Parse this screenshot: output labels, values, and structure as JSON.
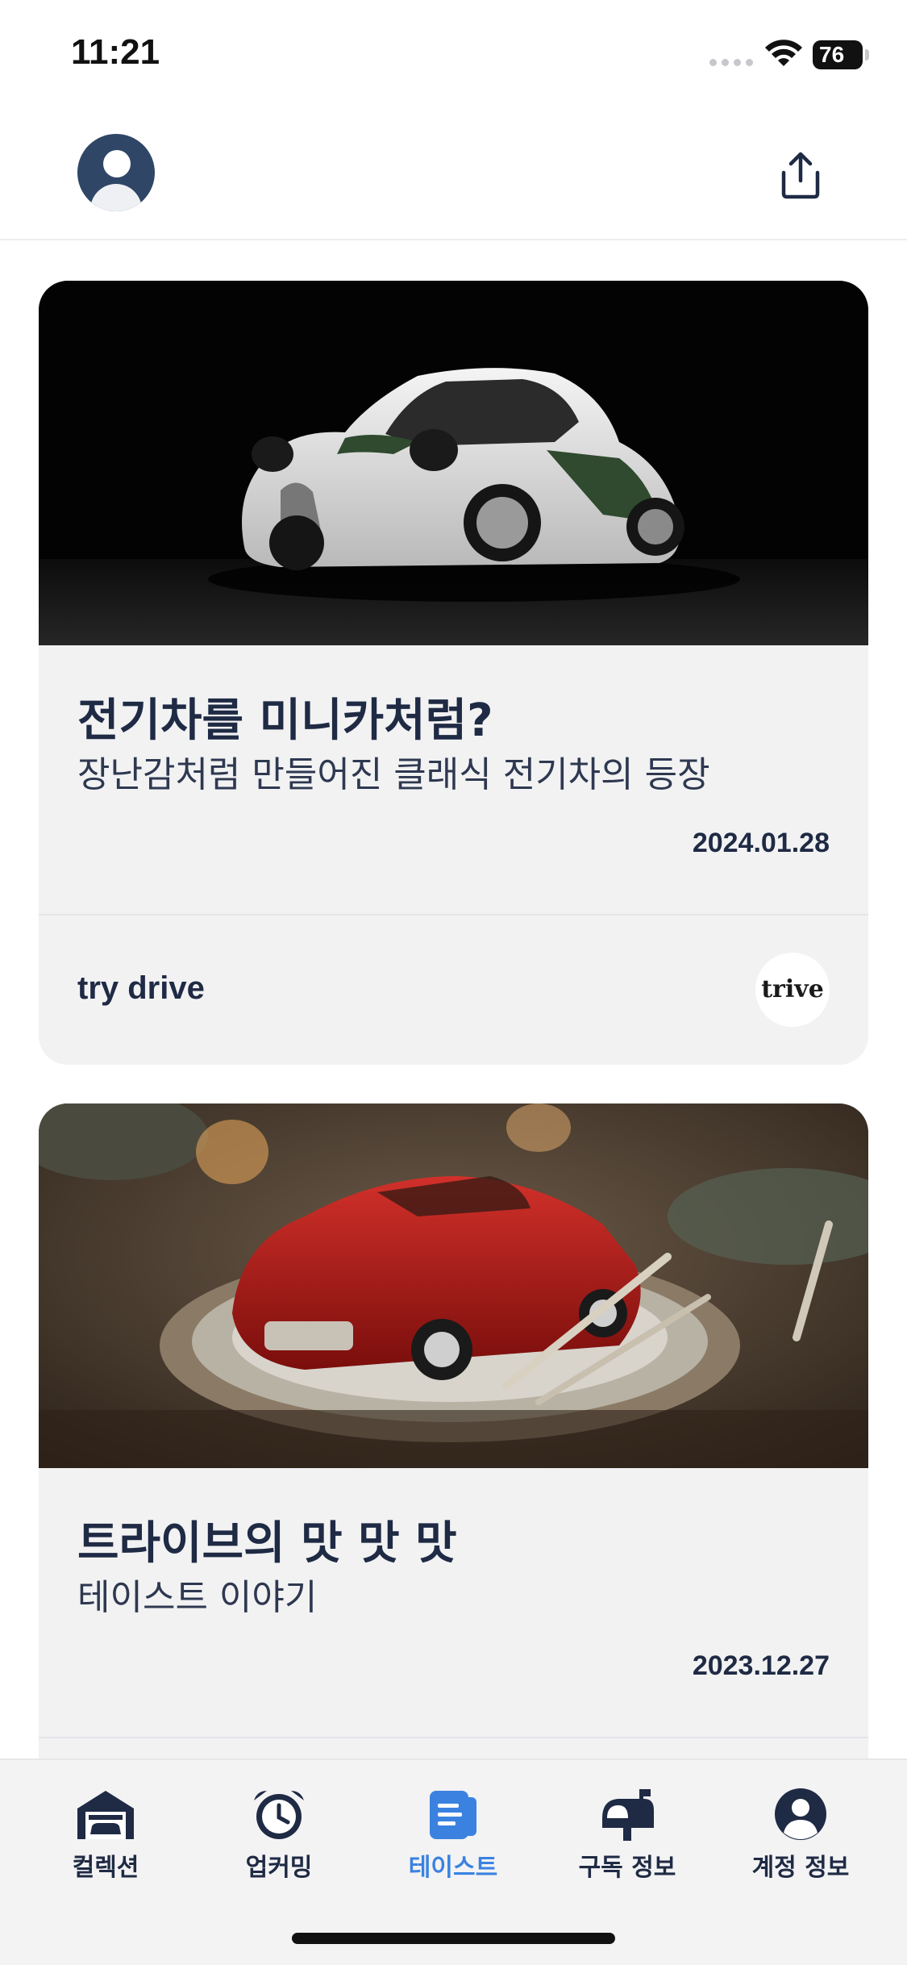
{
  "status": {
    "time": "11:21",
    "battery": "76"
  },
  "header": {
    "avatar_icon": "user-avatar-icon",
    "share_icon": "share-upload-icon"
  },
  "articles": [
    {
      "title": "전기차를 미니카처럼?",
      "subtitle": "장난감처럼 만들어진 클래식 전기차의 등장",
      "date": "2024.01.28",
      "publisher": "try drive",
      "publisher_logo": "trive",
      "image": "white-retro-electric-car-on-black"
    },
    {
      "title": "트라이브의 맛 맛 맛",
      "subtitle": "테이스트 이야기",
      "date": "2023.12.27",
      "image": "red-model-car-on-dinner-plate"
    }
  ],
  "tabs": [
    {
      "label": "컬렉션",
      "icon": "garage-icon",
      "active": false
    },
    {
      "label": "업커밍",
      "icon": "alarm-clock-icon",
      "active": false
    },
    {
      "label": "테이스트",
      "icon": "scroll-document-icon",
      "active": true
    },
    {
      "label": "구독 정보",
      "icon": "mailbox-icon",
      "active": false
    },
    {
      "label": "계정 정보",
      "icon": "account-circle-icon",
      "active": false
    }
  ],
  "colors": {
    "accent": "#3b82e0",
    "text": "#1f2a44",
    "card_bg": "#f2f2f3",
    "tab_bg": "#f3f3f4"
  }
}
